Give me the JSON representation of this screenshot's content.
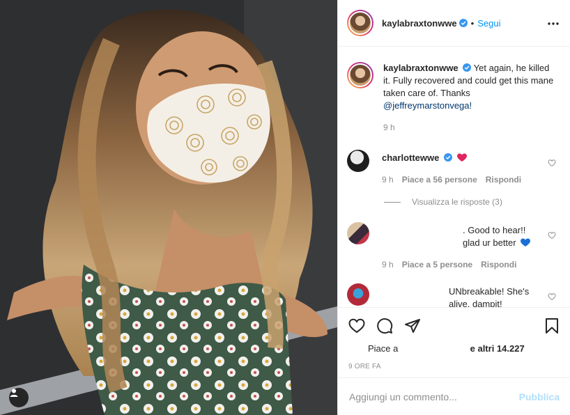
{
  "post": {
    "username": "kaylabraxtonwwe",
    "follow_label": "Segui",
    "dot": "•",
    "caption_text": "Yet again, he killed it. Fully recovered and could get this mane taken care of. Thanks",
    "caption_mention": "@jeffreymarstonvega!",
    "caption_time": "9 h"
  },
  "comments": [
    {
      "username": "charlottewwe",
      "text": "",
      "time": "9 h",
      "likes": "Piace a 56 persone",
      "reply": "Rispondi"
    },
    {
      "username": "",
      "text": ". Good to hear!! glad ur better",
      "time": "9 h",
      "likes": "Piace a 5 persone",
      "reply": "Rispondi"
    },
    {
      "username": "",
      "text": "UNbreakable! She's alive, dampit!"
    }
  ],
  "view_replies": "Visualizza le risposte (3)",
  "likes": {
    "prefix": "Piace a",
    "suffix": "e altri 14.227"
  },
  "posted_ago": "9 ORE FA",
  "add_comment": {
    "placeholder": "Aggiungi un commento...",
    "publish_label": "Pubblica"
  },
  "colors": {
    "accent": "#0095f6",
    "verified": "#3897f0",
    "muted": "#8e8e8e",
    "publish_disabled": "#b2dffc"
  },
  "icons": [
    "more-options-icon",
    "verified-icon",
    "heart-icon",
    "comment-icon",
    "share-icon",
    "save-icon",
    "tag-user-icon",
    "red-heart-icon",
    "blue-heart-icon"
  ]
}
